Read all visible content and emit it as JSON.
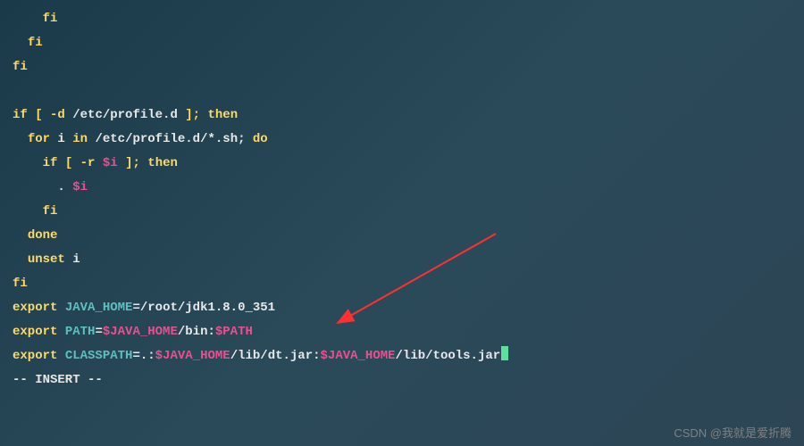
{
  "code": {
    "fi1": "fi",
    "fi2": "fi",
    "fi3": "fi",
    "if": "if",
    "test_d_open": " [ ",
    "test_d_flag": "-d",
    "path_profiled": " /etc/profile.d ",
    "test_close": "]; ",
    "then": "then",
    "for": "for",
    "for_var": " i ",
    "in": "in",
    "glob_path": " /etc/profile.d/*.sh; ",
    "do": "do",
    "if2": "if",
    "test_r_flag": "-r",
    "var_i1": "$i",
    "space_after_var": " ",
    "dot": ". ",
    "var_i2": "$i",
    "fi4": "fi",
    "done": "done",
    "unset": "unset",
    "unset_var": " i",
    "fi5": "fi",
    "export": "export",
    "java_home_name": "JAVA_HOME",
    "eq": "=",
    "java_home_val": "/root/jdk1.8.0_351",
    "path_name": "PATH",
    "path_var1": "$JAVA_HOME",
    "path_mid": "/bin:",
    "path_var2": "$PATH",
    "classpath_name": "CLASSPATH",
    "classpath_start": ".:",
    "classpath_var1": "$JAVA_HOME",
    "classpath_mid1": "/lib/dt.jar:",
    "classpath_var2": "$JAVA_HOME",
    "classpath_end": "/lib/tools.jar"
  },
  "mode": "-- INSERT --",
  "watermark": "CSDN @我就是爱折腾"
}
